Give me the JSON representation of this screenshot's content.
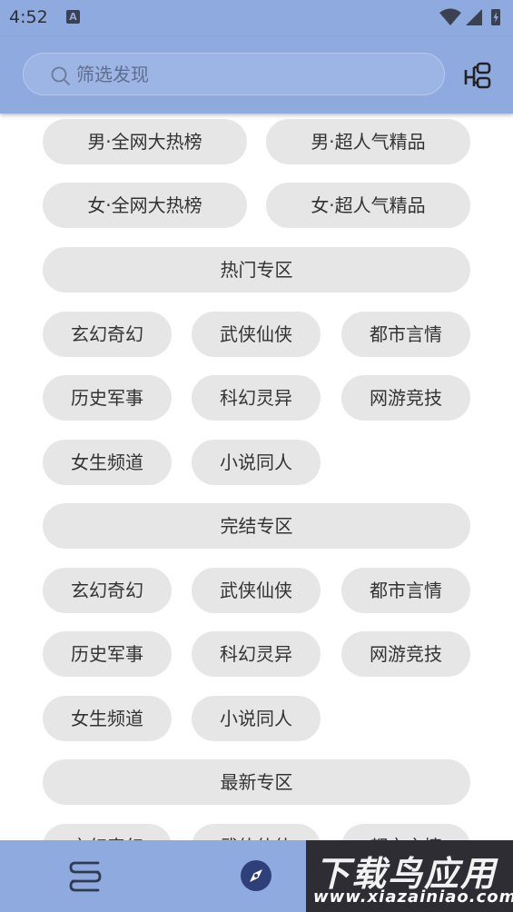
{
  "status_bar": {
    "time": "4:52",
    "notification_badge": "A"
  },
  "top_bar": {
    "search_placeholder": "筛选发现"
  },
  "rows": {
    "r1": [
      "男·全网大热榜",
      "男·超人气精品"
    ],
    "r2": [
      "女·全网大热榜",
      "女·超人气精品"
    ],
    "section1": "热门专区",
    "hot": [
      "玄幻奇幻",
      "武侠仙侠",
      "都市言情",
      "历史军事",
      "科幻灵异",
      "网游竞技",
      "女生频道",
      "小说同人"
    ],
    "section2": "完结专区",
    "finished": [
      "玄幻奇幻",
      "武侠仙侠",
      "都市言情",
      "历史军事",
      "科幻灵异",
      "网游竞技",
      "女生频道",
      "小说同人"
    ],
    "section3": "最新专区",
    "latest_partial": [
      "玄幻奇幻",
      "武侠仙侠",
      "都市言情"
    ]
  },
  "bottom_nav": {
    "icons": [
      "bookshelf-icon",
      "compass-icon"
    ]
  },
  "watermark": {
    "main": "下载鸟应用",
    "sub": "www.xiazainiao.com"
  },
  "colors": {
    "bar": "#8faadf",
    "pill": "#e6e6e6",
    "text": "#333333"
  }
}
